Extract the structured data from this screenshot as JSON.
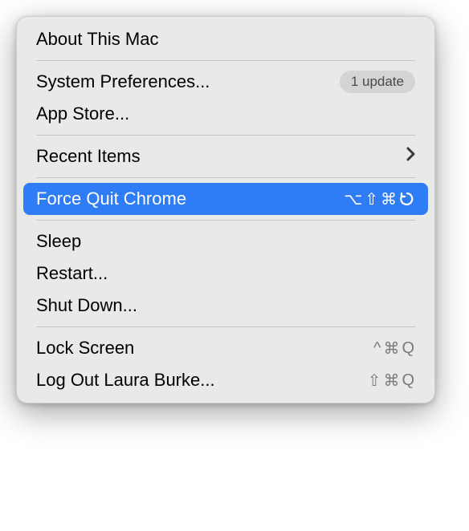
{
  "menu": {
    "about": "About This Mac",
    "system_prefs": "System Preferences...",
    "system_prefs_badge": "1 update",
    "app_store": "App Store...",
    "recent_items": "Recent Items",
    "force_quit": "Force Quit Chrome",
    "force_quit_shortcut": {
      "option": "⌥",
      "shift": "⇧",
      "command": "⌘",
      "escape": "escape"
    },
    "sleep": "Sleep",
    "restart": "Restart...",
    "shut_down": "Shut Down...",
    "lock_screen": "Lock Screen",
    "lock_screen_shortcut": {
      "control": "^",
      "command": "⌘",
      "key": "Q"
    },
    "log_out": "Log Out Laura Burke...",
    "log_out_shortcut": {
      "shift": "⇧",
      "command": "⌘",
      "key": "Q"
    }
  }
}
